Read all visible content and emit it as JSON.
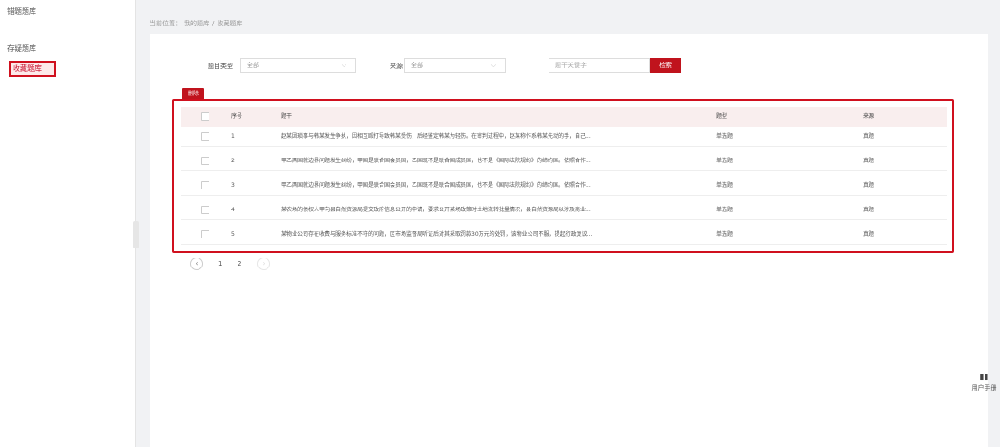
{
  "sidebar": {
    "items": [
      {
        "label": "错题题库"
      },
      {
        "label": "存疑题库"
      },
      {
        "label": "收藏题库"
      }
    ]
  },
  "breadcrumb": {
    "prefix": "当前位置：",
    "level1": "我的题库",
    "sep": "/",
    "level2": "收藏题库"
  },
  "filters": {
    "type_label": "题目类型",
    "type_value": "全部",
    "source_label": "来源",
    "source_value": "全部",
    "keyword_placeholder": "题干关键字",
    "search_label": "检索"
  },
  "toolbar": {
    "delete_label": "删除"
  },
  "table": {
    "headers": {
      "no": "序号",
      "stem": "题干",
      "type": "题型",
      "source": "来源"
    },
    "rows": [
      {
        "no": "1",
        "stem": "赵某因琐事与韩某发生争执，因相互殴打导致韩某受伤，后经鉴定韩某为轻伤。在审判过程中，赵某称作系韩某先动的手，自己...",
        "type": "单选题",
        "source": "真题"
      },
      {
        "no": "2",
        "stem": "甲乙两国就边界问题发生纠纷，甲国是联合国会员国，乙国既不是联合国成员国，也不是《国际法院规约》的缔约国。依照合作...",
        "type": "单选题",
        "source": "真题"
      },
      {
        "no": "3",
        "stem": "甲乙两国就边界问题发生纠纷，甲国是联合国会员国，乙国既不是联合国成员国，也不是《国际法院规约》的缔约国。依照合作...",
        "type": "单选题",
        "source": "真题"
      },
      {
        "no": "4",
        "stem": "某农场的债权人甲向县自然资源局提交政府信息公开的申请，要求公开某场政策时土地流转批量情况，县自然资源局以涉及商业...",
        "type": "单选题",
        "source": "真题"
      },
      {
        "no": "5",
        "stem": "某物业公司存在收费与服务标准不符的问题，区市场监督局听证后对其采取罚款30万元的处罚，该物业公司不服，提起行政复议...",
        "type": "单选题",
        "source": "真题"
      }
    ]
  },
  "pagination": {
    "prev": "‹",
    "pages": [
      "1",
      "2"
    ],
    "next": "›"
  },
  "manual": {
    "icon": "book-icon",
    "label": "用户手册"
  }
}
